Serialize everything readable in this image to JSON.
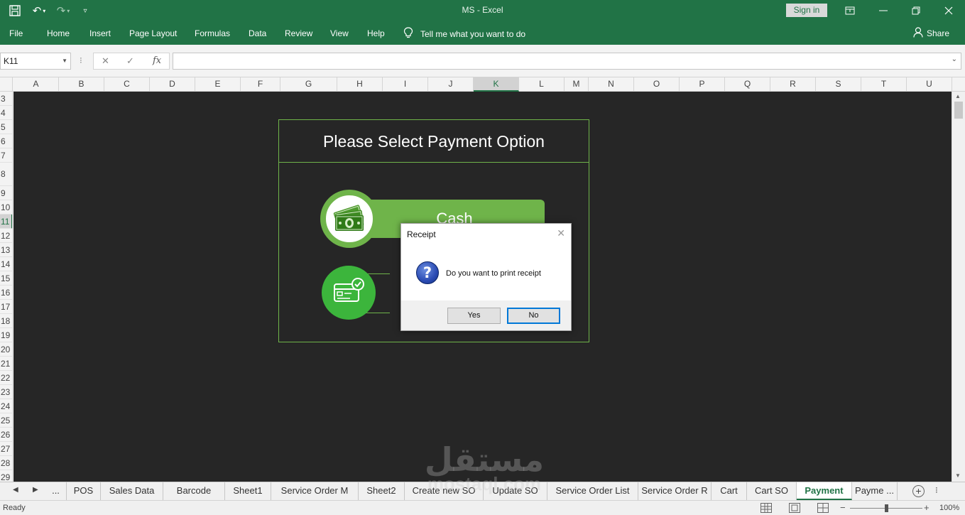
{
  "window": {
    "title": "MS  -  Excel",
    "sign_in": "Sign in",
    "quick_access": [
      "save-icon",
      "undo-icon",
      "redo-icon",
      "customize-icon"
    ],
    "controls": [
      "ribbon-display-icon",
      "minimize-icon",
      "restore-icon",
      "close-icon"
    ]
  },
  "ribbon": {
    "tabs": [
      "File",
      "Home",
      "Insert",
      "Page Layout",
      "Formulas",
      "Data",
      "Review",
      "View",
      "Help"
    ],
    "tell_me": "Tell me what you want to do",
    "share": "Share"
  },
  "formula_bar": {
    "name_box": "K11",
    "fx": "fx",
    "formula": ""
  },
  "columns": [
    "A",
    "B",
    "C",
    "D",
    "E",
    "F",
    "G",
    "H",
    "I",
    "J",
    "K",
    "L",
    "M",
    "N",
    "O",
    "P",
    "Q",
    "R",
    "S",
    "T",
    "U"
  ],
  "selected_column": "K",
  "rows": [
    "3",
    "4",
    "5",
    "6",
    "7",
    "8",
    "9",
    "10",
    "11",
    "12",
    "13",
    "14",
    "15",
    "16",
    "17",
    "18",
    "19",
    "20",
    "21",
    "22",
    "23",
    "24",
    "25",
    "26",
    "27",
    "28",
    "29"
  ],
  "selected_row": "11",
  "payment_panel": {
    "title": "Please Select Payment Option",
    "cash_label": "Cash",
    "cash_icon": "money-icon",
    "card_icon": "credit-card-check-icon"
  },
  "dialog": {
    "title": "Receipt",
    "message": "Do you want to print receipt",
    "icon": "question-icon",
    "yes": "Yes",
    "no": "No"
  },
  "sheet_tabs": {
    "ellipsis": "...",
    "items": [
      "POS",
      "Sales Data",
      "Barcode",
      "Sheet1",
      "Service Order M",
      "Sheet2",
      "Create new SO",
      "Update SO",
      "Service Order List",
      "Service Order R",
      "Cart",
      "Cart SO",
      "Payment",
      "Payme ..."
    ],
    "active": "Payment"
  },
  "status": {
    "ready": "Ready",
    "zoom": "100%",
    "zoom_fraction": 0.5
  },
  "watermark": {
    "arabic": "مستقل",
    "latin": "mostaql.com"
  },
  "colors": {
    "excel_green": "#217346",
    "panel_green": "#6fb44a",
    "card_green": "#3cb53c",
    "sheet_bg": "#262626"
  }
}
